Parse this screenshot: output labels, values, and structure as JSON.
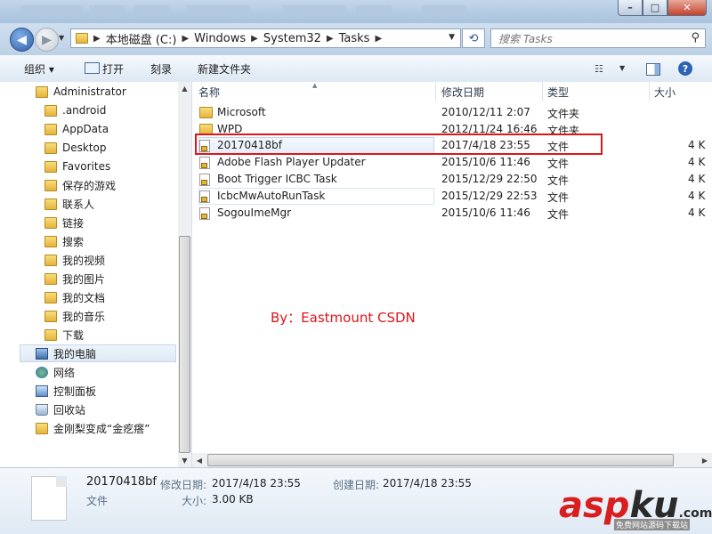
{
  "titlebar": {
    "controls": {
      "minimize": "–",
      "maximize": "□",
      "close": "✕"
    }
  },
  "address": {
    "crumbs": [
      "本地磁盘 (C:)",
      "Windows",
      "System32",
      "Tasks"
    ],
    "separator": "▶",
    "search_placeholder": "搜索 Tasks"
  },
  "toolbar": {
    "organize": "组织 ▾",
    "open": "打开",
    "burn": "刻录",
    "new_folder": "新建文件夹"
  },
  "nav": {
    "items": [
      {
        "label": "Administrator",
        "icon": "user-folder-icon"
      },
      {
        "label": ".android",
        "icon": "folder-icon"
      },
      {
        "label": "AppData",
        "icon": "folder-icon"
      },
      {
        "label": "Desktop",
        "icon": "folder-icon"
      },
      {
        "label": "Favorites",
        "icon": "star-folder-icon"
      },
      {
        "label": "保存的游戏",
        "icon": "games-folder-icon"
      },
      {
        "label": "联系人",
        "icon": "contacts-folder-icon"
      },
      {
        "label": "链接",
        "icon": "links-folder-icon"
      },
      {
        "label": "搜索",
        "icon": "search-folder-icon"
      },
      {
        "label": "我的视频",
        "icon": "videos-folder-icon"
      },
      {
        "label": "我的图片",
        "icon": "pictures-folder-icon"
      },
      {
        "label": "我的文档",
        "icon": "documents-folder-icon"
      },
      {
        "label": "我的音乐",
        "icon": "music-folder-icon"
      },
      {
        "label": "下载",
        "icon": "downloads-folder-icon"
      },
      {
        "label": "我的电脑",
        "icon": "computer-icon"
      },
      {
        "label": "网络",
        "icon": "network-icon"
      },
      {
        "label": "控制面板",
        "icon": "control-panel-icon"
      },
      {
        "label": "回收站",
        "icon": "recycle-bin-icon"
      },
      {
        "label": "金刚梨变成“金疙瘩”",
        "icon": "folder-icon"
      }
    ]
  },
  "columns": {
    "name": "名称",
    "modified": "修改日期",
    "type": "类型",
    "size": "大小"
  },
  "files": [
    {
      "name": "Microsoft",
      "modified": "2010/12/11 2:07",
      "type": "文件夹",
      "size": "",
      "kind": "folder"
    },
    {
      "name": "WPD",
      "modified": "2012/11/24 16:46",
      "type": "文件夹",
      "size": "",
      "kind": "folder"
    },
    {
      "name": "20170418bf",
      "modified": "2017/4/18 23:55",
      "type": "文件",
      "size": "4 K",
      "kind": "file"
    },
    {
      "name": "Adobe Flash Player Updater",
      "modified": "2015/10/6 11:46",
      "type": "文件",
      "size": "4 K",
      "kind": "file"
    },
    {
      "name": "Boot Trigger ICBC Task",
      "modified": "2015/12/29 22:50",
      "type": "文件",
      "size": "4 K",
      "kind": "file"
    },
    {
      "name": "IcbcMwAutoRunTask",
      "modified": "2015/12/29 22:53",
      "type": "文件",
      "size": "4 K",
      "kind": "file"
    },
    {
      "name": "SogouImeMgr",
      "modified": "2015/10/6 11:46",
      "type": "文件",
      "size": "4 K",
      "kind": "file"
    }
  ],
  "annotation": "By：Eastmount CSDN",
  "details": {
    "name": "20170418bf",
    "type": "文件",
    "modified_label": "修改日期:",
    "modified_value": "2017/4/18 23:55",
    "created_label": "创建日期:",
    "created_value": "2017/4/18 23:55",
    "size_label": "大小:",
    "size_value": "3.00 KB"
  },
  "logo": {
    "part1": "asp",
    "part2": "ku",
    "suffix": ".com",
    "sub": "免费网站源码下载站"
  },
  "colors": {
    "highlight_box": "#e0151b",
    "folder": "#e4b43d",
    "accent": "#2e5ea8"
  }
}
